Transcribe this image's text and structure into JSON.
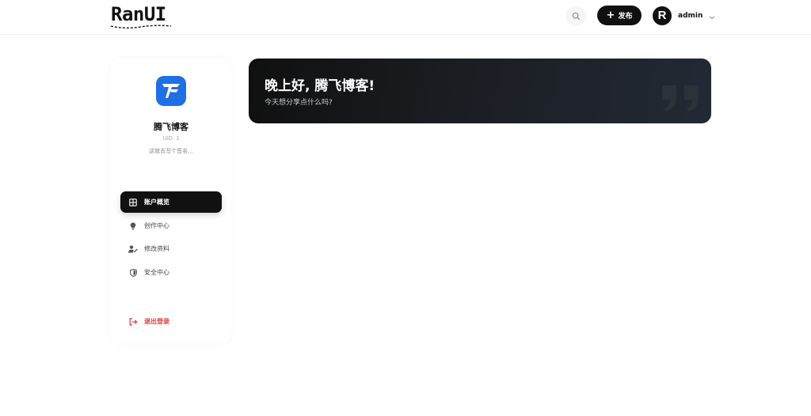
{
  "header": {
    "logo_text": "RanUI",
    "publish_label": "发布",
    "avatar_letter": "R",
    "username": "admin",
    "icons": {
      "search": "search-icon",
      "plus": "plus-icon",
      "chevron": "chevron-down-icon"
    }
  },
  "profile": {
    "name": "腾飞博客",
    "uid": "UID: 1",
    "signature": "这就去写个签名..."
  },
  "menu": {
    "items": [
      {
        "label": "账户概览",
        "icon": "grid-icon",
        "active": true
      },
      {
        "label": "创作中心",
        "icon": "lightbulb-icon",
        "active": false
      },
      {
        "label": "修改资料",
        "icon": "user-edit-icon",
        "active": false
      },
      {
        "label": "安全中心",
        "icon": "shield-icon",
        "active": false
      }
    ],
    "logout": {
      "label": "退出登录",
      "icon": "logout-icon"
    }
  },
  "banner": {
    "title": "晚上好, 腾飞博客!",
    "subtitle": "今天想分享点什么吗?"
  },
  "colors": {
    "brand_dark": "#111111",
    "profile_logo_blue": "#1f6fe5",
    "logout_red": "#e03a3a"
  }
}
